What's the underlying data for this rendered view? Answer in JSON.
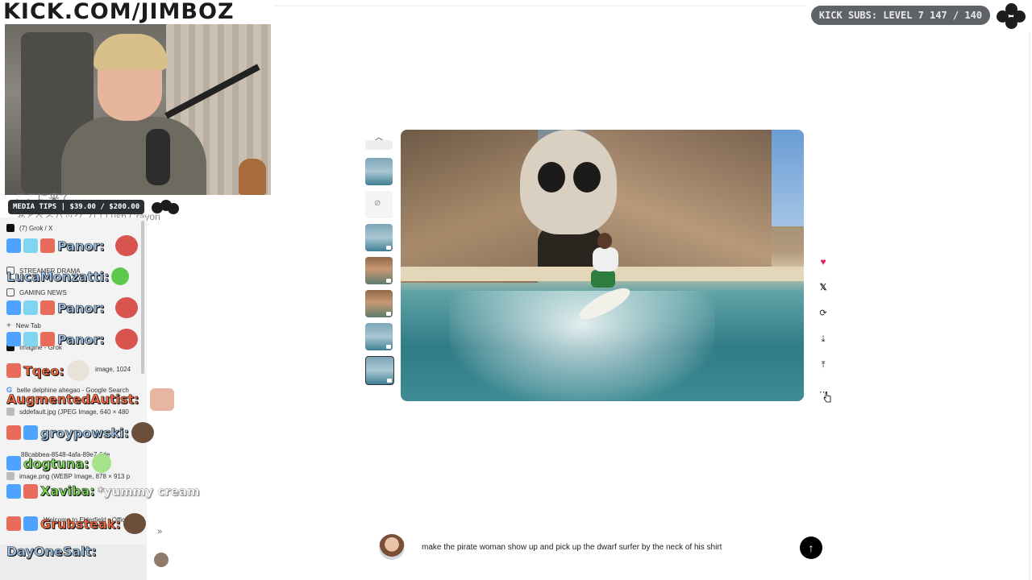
{
  "stream": {
    "title": "KICK.COM/JIMBOZ",
    "media_tips": "MEDIA TIPS | $39.00 / $200.00",
    "subs": "KICK SUBS: LEVEL 7 147 / 140",
    "jp_text": "ここに来て",
    "jp_text2": "あとべるバックフロ Lush Crayon"
  },
  "browser_sidebar": {
    "items": [
      {
        "label": "(7) Grok / X",
        "icon": "x-icon",
        "color": "#111111"
      },
      {
        "label": "STREAMER DRAMA",
        "icon": "folder-icon",
        "color": "#555555"
      },
      {
        "label": "GAMING NEWS",
        "icon": "folder-icon",
        "color": "#555555"
      },
      {
        "label": "New Tab",
        "icon": "plus-icon",
        "color": "#555555"
      },
      {
        "label": "Imagine - Grok",
        "icon": "grok-icon",
        "color": "#111111"
      },
      {
        "label": "image, 1024",
        "icon": "image-icon",
        "color": "#888888"
      },
      {
        "label": "belle delphine ahegao - Google Search",
        "icon": "google-icon",
        "color": "#4285f4"
      },
      {
        "label": "sddefault.jpg (JPEG Image, 640 × 480",
        "icon": "image-icon",
        "color": "#888888"
      },
      {
        "label": "88cabbea-8548-4afa-89e7-6de",
        "icon": "image-icon",
        "color": "#888888"
      },
      {
        "label": "image.png (WEBP Image, 878 × 913 p",
        "icon": "image-icon",
        "color": "#888888"
      },
      {
        "label": "Welcome to Elderfield - Official De",
        "icon": "page-icon",
        "color": "#888888"
      }
    ]
  },
  "chat": [
    {
      "name": "Panor:",
      "message": "",
      "name_color": "#9ec3e6"
    },
    {
      "name": "LucaMonzatti:",
      "message": "",
      "name_color": "#9ec3e6"
    },
    {
      "name": "Panor:",
      "message": "",
      "name_color": "#9ec3e6"
    },
    {
      "name": "Panor:",
      "message": "",
      "name_color": "#9ec3e6"
    },
    {
      "name": "Tqeo:",
      "message": "",
      "name_color": "#ff6a3d"
    },
    {
      "name": "AugmentedAutist:",
      "message": "",
      "name_color": "#ff6a3d"
    },
    {
      "name": "groypowski:",
      "message": "",
      "name_color": "#9ec3e6"
    },
    {
      "name": "dogtuna:",
      "message": "",
      "name_color": "#7ee05a"
    },
    {
      "name": "Xaviba:",
      "message": "*yummy cream",
      "name_color": "#7ee05a"
    },
    {
      "name": "Grubsteak:",
      "message": "",
      "name_color": "#ff6a3d"
    },
    {
      "name": "DayOneSalt:",
      "message": "",
      "name_color": "#9ec3e6"
    }
  ],
  "grok": {
    "thumbnails": [
      "surf",
      "hidden",
      "surf",
      "woman",
      "woman",
      "surf",
      "surf"
    ],
    "actions": [
      "heart-icon",
      "x-logo-icon",
      "refresh-icon",
      "download-icon",
      "share-icon",
      "more-icon"
    ],
    "prompt": "make the pirate woman show up and pick up the dwarf surfer by the neck of his shirt",
    "send_label": "↑"
  },
  "colors": {
    "accent": "#e0245e",
    "overlay_dark": "#2c3033",
    "subs_pill": "#5f6368"
  }
}
